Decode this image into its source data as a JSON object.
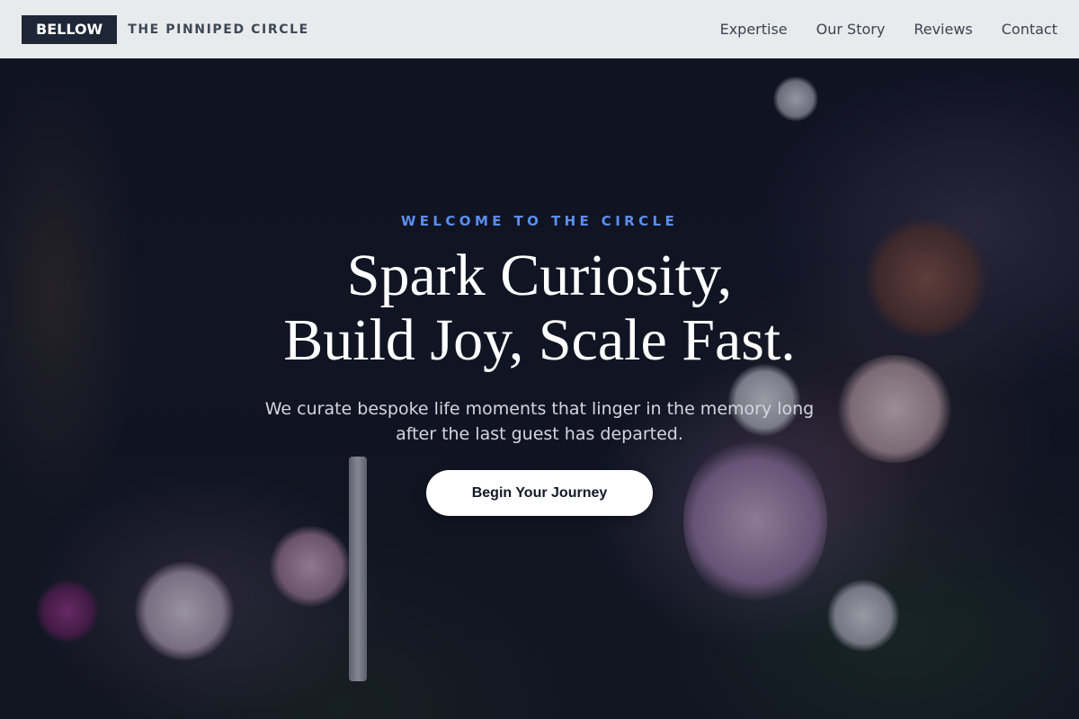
{
  "header": {
    "logo": "BELLOW",
    "brand_subtitle": "THE PINNIPED CIRCLE",
    "nav": [
      {
        "label": "Expertise"
      },
      {
        "label": "Our Story"
      },
      {
        "label": "Reviews"
      },
      {
        "label": "Contact"
      }
    ]
  },
  "hero": {
    "eyebrow": "WELCOME TO THE CIRCLE",
    "headline_line1": "Spark Curiosity,",
    "headline_line2": "Build Joy, Scale Fast.",
    "subtext": "We curate bespoke life moments that linger in the memory long after the last guest has departed.",
    "cta_label": "Begin Your Journey"
  },
  "colors": {
    "nav_bg": "#e9eaec",
    "logo_bg": "#1e2638",
    "accent": "#5b8ef0",
    "cta_bg": "#ffffff"
  }
}
